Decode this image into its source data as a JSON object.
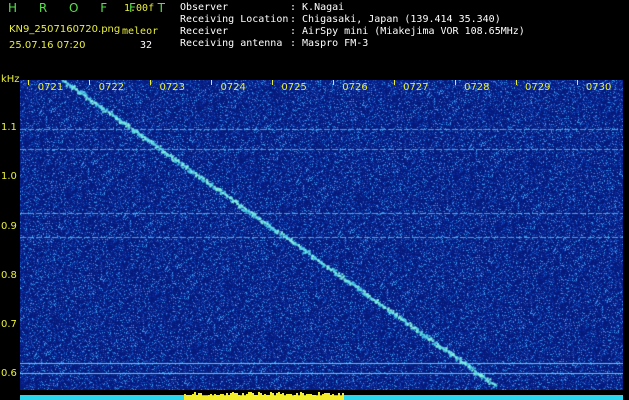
{
  "header": {
    "brand": "H R O F F T",
    "version": "1.00f",
    "filename": "KN9_2507160720.png",
    "meteor_label": "meleor",
    "meteor_count": "32",
    "datetime": "25.07.16 07:20"
  },
  "info": [
    {
      "key": "Observer",
      "value": ": K.Nagai"
    },
    {
      "key": "Receiving Location",
      "value": ": Chigasaki, Japan (139.414 35.340)"
    },
    {
      "key": "Receiver",
      "value": ": AirSpy mini (Miakejima VOR 108.65MHz)"
    },
    {
      "key": "Receiving antenna",
      "value": ": Maspro FM-3"
    }
  ],
  "colors": {
    "background": "#000000",
    "plot_bg": "#061a7c",
    "label_yellow": "#e9ef3c",
    "brand_green": "#57e14a",
    "signal_cyan": "#5fe0e8",
    "noise_bar_cyan": "#2ad6ee",
    "noise_bar_yellow": "#f2ee2c"
  },
  "chart_data": {
    "type": "heatmap",
    "ylabel": "kHz",
    "yticks": [
      "1.1",
      "1.0",
      "0.9",
      "0.8",
      "0.7",
      "0.6"
    ],
    "ytick_values": [
      1.1,
      1.0,
      0.9,
      0.8,
      0.7,
      0.6
    ],
    "ylim": [
      0.57,
      1.2
    ],
    "xticks": [
      "0721",
      "0722",
      "0723",
      "0724",
      "0725",
      "0726",
      "0727",
      "0728",
      "0729",
      "0730"
    ],
    "xtick_values": [
      721,
      722,
      723,
      724,
      725,
      726,
      727,
      728,
      729,
      730
    ],
    "xlim": [
      720.5,
      730.4
    ],
    "horizontal_lines_khz": [
      1.1,
      1.06,
      0.93,
      0.88,
      0.625,
      0.605
    ],
    "diagonal_trace": {
      "start": [
        721.2,
        1.2
      ],
      "end": [
        728.3,
        0.58
      ]
    },
    "yellow_burst": {
      "start": 723.2,
      "end": 725.8
    }
  }
}
